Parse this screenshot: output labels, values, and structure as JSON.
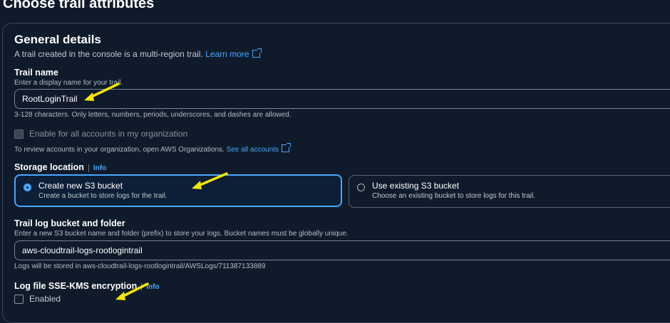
{
  "page": {
    "title": "Choose trail attributes"
  },
  "general": {
    "heading": "General details",
    "description": "A trail created in the console is a multi-region trail.",
    "learn_more": "Learn more"
  },
  "trail_name": {
    "label": "Trail name",
    "hint": "Enter a display name for your trail.",
    "value": "RootLoginTrail",
    "constraint": "3-128 characters. Only letters, numbers, periods, underscores, and dashes are allowed."
  },
  "org": {
    "checkbox_label": "Enable for all accounts in my organization",
    "hint": "To review accounts in your organization, open AWS Organizations.",
    "see_all": "See all accounts"
  },
  "storage": {
    "label": "Storage location",
    "info": "Info",
    "options": [
      {
        "title": "Create new S3 bucket",
        "description": "Create a bucket to store logs for the trail.",
        "selected": true
      },
      {
        "title": "Use existing S3 bucket",
        "description": "Choose an existing bucket to store logs for this trail.",
        "selected": false
      }
    ]
  },
  "bucket": {
    "label": "Trail log bucket and folder",
    "hint": "Enter a new S3 bucket name and folder (prefix) to store your logs. Bucket names must be globally unique.",
    "value": "aws-cloudtrail-logs-rootlogintrail",
    "stored_note": "Logs will be stored in aws-cloudtrail-logs-rootlogintrail/AWSLogs/711387133889"
  },
  "encryption": {
    "label": "Log file SSE-KMS encryption",
    "info": "Info",
    "checkbox_label": "Enabled"
  },
  "colors": {
    "accent": "#4aa6ff",
    "background": "#0f1b2a",
    "annotation_arrow": "#f5e600"
  }
}
